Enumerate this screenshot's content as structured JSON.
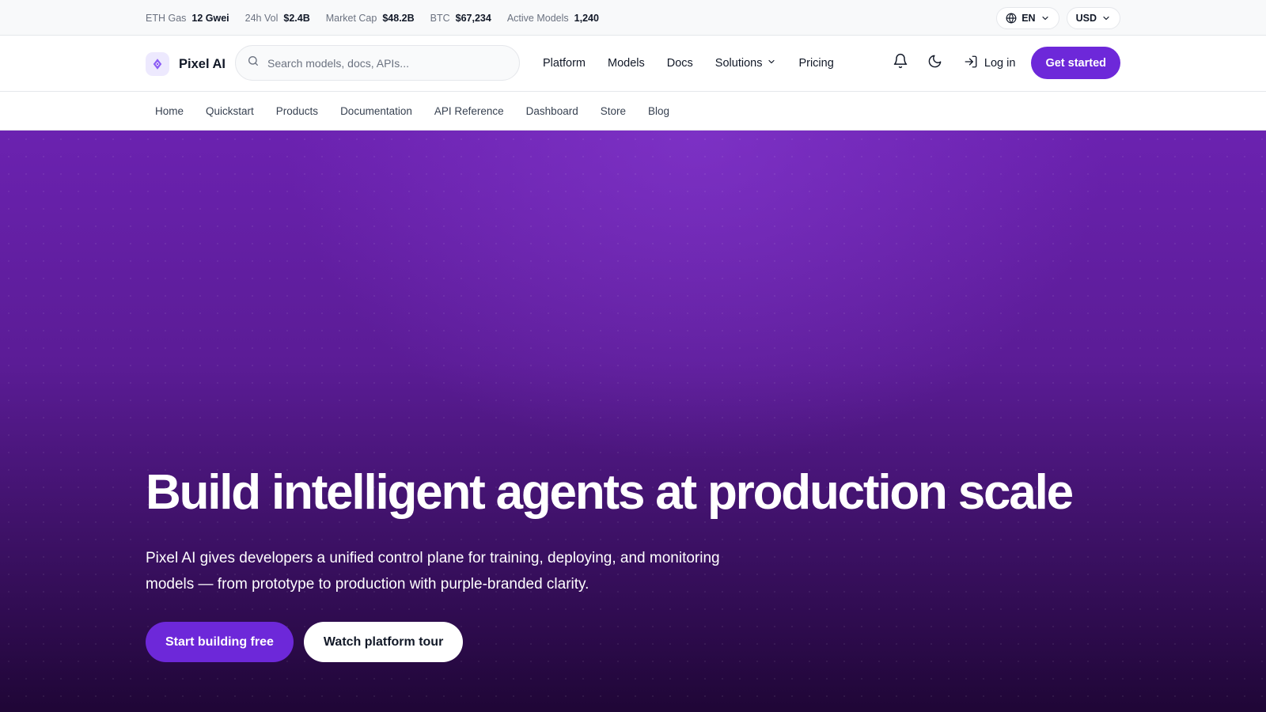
{
  "ticker": {
    "items": [
      {
        "label": "ETH Gas",
        "value": "12 Gwei"
      },
      {
        "label": "24h Vol",
        "value": "$2.4B"
      },
      {
        "label": "Market Cap",
        "value": "$48.2B"
      },
      {
        "label": "BTC",
        "value": "$67,234"
      },
      {
        "label": "Active Models",
        "value": "1,240"
      }
    ],
    "language": "EN",
    "currency": "USD"
  },
  "header": {
    "brand": "Pixel AI",
    "search_placeholder": "Search models, docs, APIs...",
    "nav": [
      "Platform",
      "Models",
      "Docs",
      "Solutions",
      "Pricing"
    ],
    "login_label": "Log in",
    "cta_label": "Get started"
  },
  "subnav": [
    "Home",
    "Quickstart",
    "Products",
    "Documentation",
    "API Reference",
    "Dashboard",
    "Store",
    "Blog"
  ],
  "hero": {
    "title": "Build intelligent agents at production scale",
    "subtitle": "Pixel AI gives developers a unified control plane for training, deploying, and monitoring models — from prototype to production with purple-branded clarity.",
    "primary_cta": "Start building free",
    "secondary_cta": "Watch platform tour"
  },
  "colors": {
    "accent": "#6d28d9",
    "hero_top": "#6b22b0",
    "hero_bottom": "#1f0636"
  },
  "icons": [
    "globe-icon",
    "chevron-down-icon",
    "logo-icon",
    "search-icon",
    "bell-icon",
    "moon-icon",
    "log-in-icon"
  ]
}
